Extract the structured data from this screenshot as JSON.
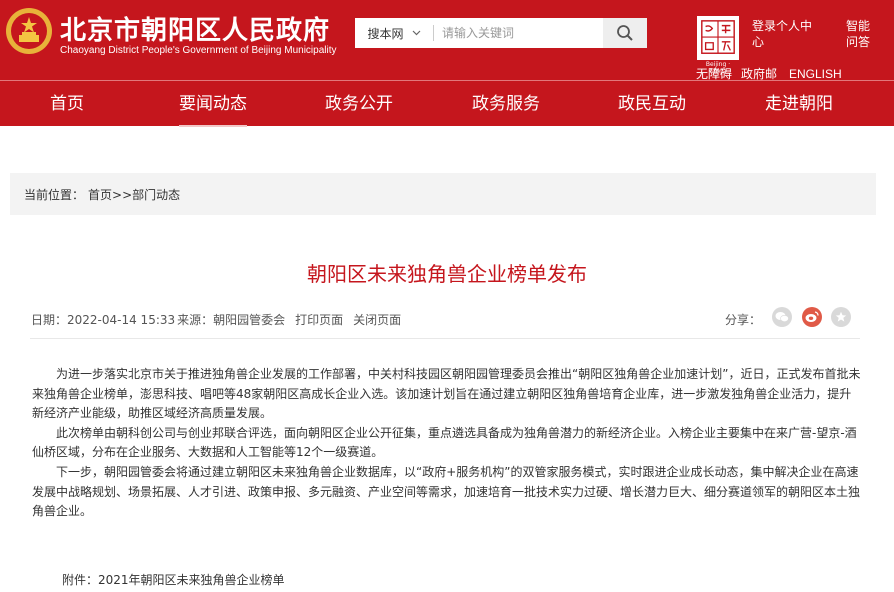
{
  "header": {
    "site_title": "北京市朝阳区人民政府",
    "site_subtitle": "Chaoyang District People's Government of Beijing Municipality",
    "logo_caption": "Beijing · China",
    "links": {
      "login": "登录个人中心",
      "smart_qa": "智能问答",
      "accessibility": "无障碍",
      "gov_mail": "政府邮",
      "english": "ENGLISH"
    }
  },
  "search": {
    "scope": "搜本网",
    "placeholder": "请输入关键词"
  },
  "nav": {
    "items": [
      "首页",
      "要闻动态",
      "政务公开",
      "政务服务",
      "政民互动",
      "走进朝阳"
    ],
    "active": "要闻动态"
  },
  "breadcrumb": {
    "label": "当前位置：",
    "path": "首页>>部门动态"
  },
  "article": {
    "title": "朝阳区未来独角兽企业榜单发布",
    "meta": {
      "date": "日期：2022-04-14 15:33",
      "source": "来源：朝阳园管委会",
      "print": "打印页面",
      "close": "关闭页面"
    },
    "share_label": "分享：",
    "paragraphs": [
      "为进一步落实北京市关于推进独角兽企业发展的工作部署，中关村科技园区朝阳园管理委员会推出“朝阳区独角兽企业加速计划”，近日，正式发布首批未来独角兽企业榜单，澎思科技、唱吧等48家朝阳区高成长企业入选。该加速计划旨在通过建立朝阳区独角兽培育企业库，进一步激发独角兽企业活力，提升新经济产业能级，助推区域经济高质量发展。",
      "此次榜单由朝科创公司与创业邦联合评选，面向朝阳区企业公开征集，重点遴选具备成为独角兽潜力的新经济企业。入榜企业主要集中在来广营-望京-酒仙桥区域，分布在企业服务、大数据和人工智能等12个一级赛道。",
      "下一步，朝阳园管委会将通过建立朝阳区未来独角兽企业数据库，以“政府+服务机构”的双管家服务模式，实时跟进企业成长动态，集中解决企业在高速发展中战略规划、场景拓展、人才引进、政策申报、多元融资、产业空间等需求，加速培育一批技术实力过硬、增长潜力巨大、细分赛道领军的朝阳区本土独角兽企业。"
    ],
    "attachment": "附件：2021年朝阳区未来独角兽企业榜单"
  },
  "colors": {
    "brand_red": "#c5161d",
    "breadcrumb_bg": "#f3f3f3"
  }
}
